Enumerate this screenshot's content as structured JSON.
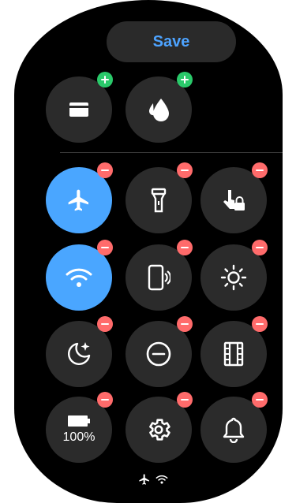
{
  "header": {
    "save_label": "Save"
  },
  "available_tiles": [
    {
      "name": "card-tile",
      "icon": "card-icon",
      "badge": "add"
    },
    {
      "name": "water-lock-tile",
      "icon": "water-drop-icon",
      "badge": "add"
    }
  ],
  "active_tiles": [
    {
      "name": "airplane-mode-tile",
      "icon": "airplane-icon",
      "state": "on",
      "badge": "remove"
    },
    {
      "name": "flashlight-tile",
      "icon": "flashlight-icon",
      "state": "off",
      "badge": "remove"
    },
    {
      "name": "touch-lock-tile",
      "icon": "touch-lock-icon",
      "state": "off",
      "badge": "remove"
    },
    {
      "name": "wifi-tile",
      "icon": "wifi-icon",
      "state": "on",
      "badge": "remove"
    },
    {
      "name": "phone-ring-tile",
      "icon": "phone-vibrate-icon",
      "state": "off",
      "badge": "remove"
    },
    {
      "name": "brightness-tile",
      "icon": "brightness-icon",
      "state": "off",
      "badge": "remove"
    },
    {
      "name": "bedtime-tile",
      "icon": "moon-star-icon",
      "state": "off",
      "badge": "remove"
    },
    {
      "name": "do-not-disturb-tile",
      "icon": "minus-circle-icon",
      "state": "off",
      "badge": "remove"
    },
    {
      "name": "theater-mode-tile",
      "icon": "film-icon",
      "state": "off",
      "badge": "remove"
    },
    {
      "name": "battery-tile",
      "icon": "battery-icon",
      "label": "100%",
      "state": "off",
      "badge": "remove"
    },
    {
      "name": "settings-tile",
      "icon": "gear-icon",
      "state": "off",
      "badge": "remove"
    },
    {
      "name": "sound-tile",
      "icon": "bell-icon",
      "state": "off",
      "badge": "remove"
    }
  ],
  "status_bar": {
    "icons": [
      "airplane-icon",
      "wifi-icon"
    ]
  },
  "colors": {
    "accent": "#4aa6ff",
    "save_text": "#4da3ff",
    "remove_badge": "#ff6b6b",
    "add_badge": "#2ac96a",
    "tile_bg": "#2b2b2b",
    "panel_bg": "#000000"
  }
}
